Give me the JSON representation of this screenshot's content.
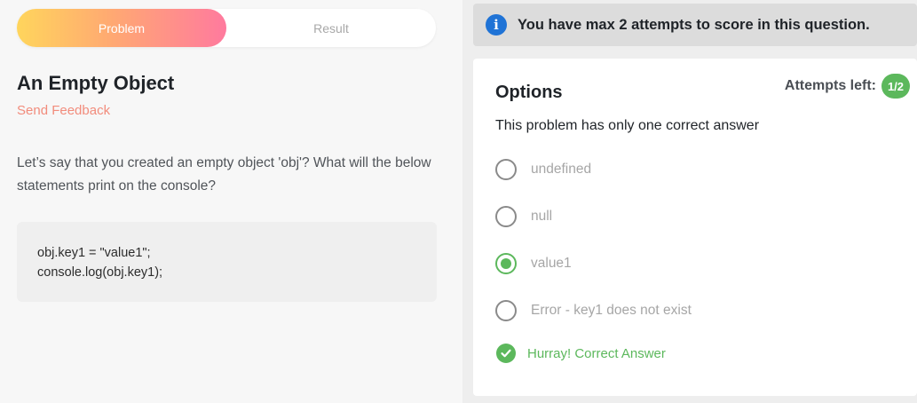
{
  "tabs": {
    "problem": "Problem",
    "result": "Result"
  },
  "problem": {
    "title": "An Empty Object",
    "feedback_link": "Send Feedback",
    "question": "Let’s say that you created an empty object 'obj'? What will the below statements print on the console?",
    "code_lines": [
      "obj.key1 = \"value1\";",
      "console.log(obj.key1);"
    ]
  },
  "banner": {
    "icon": "info-icon",
    "text": "You have max 2 attempts to score in this question."
  },
  "options_panel": {
    "title": "Options",
    "attempts_label": "Attempts left:",
    "attempts_value": "1/2",
    "instruction": "This problem has only one correct answer",
    "options": [
      {
        "label": "undefined",
        "selected": false
      },
      {
        "label": "null",
        "selected": false
      },
      {
        "label": "value1",
        "selected": true
      },
      {
        "label": "Error - key1 does not exist",
        "selected": false
      }
    ],
    "result_icon": "check-circle-icon",
    "result_text": "Hurray! Correct Answer"
  },
  "colors": {
    "tab_gradient_start": "#ffd55c",
    "tab_gradient_end": "#ff7a9e",
    "feedback": "#f28c7c",
    "success": "#5cb85c",
    "info": "#1f73d6"
  }
}
